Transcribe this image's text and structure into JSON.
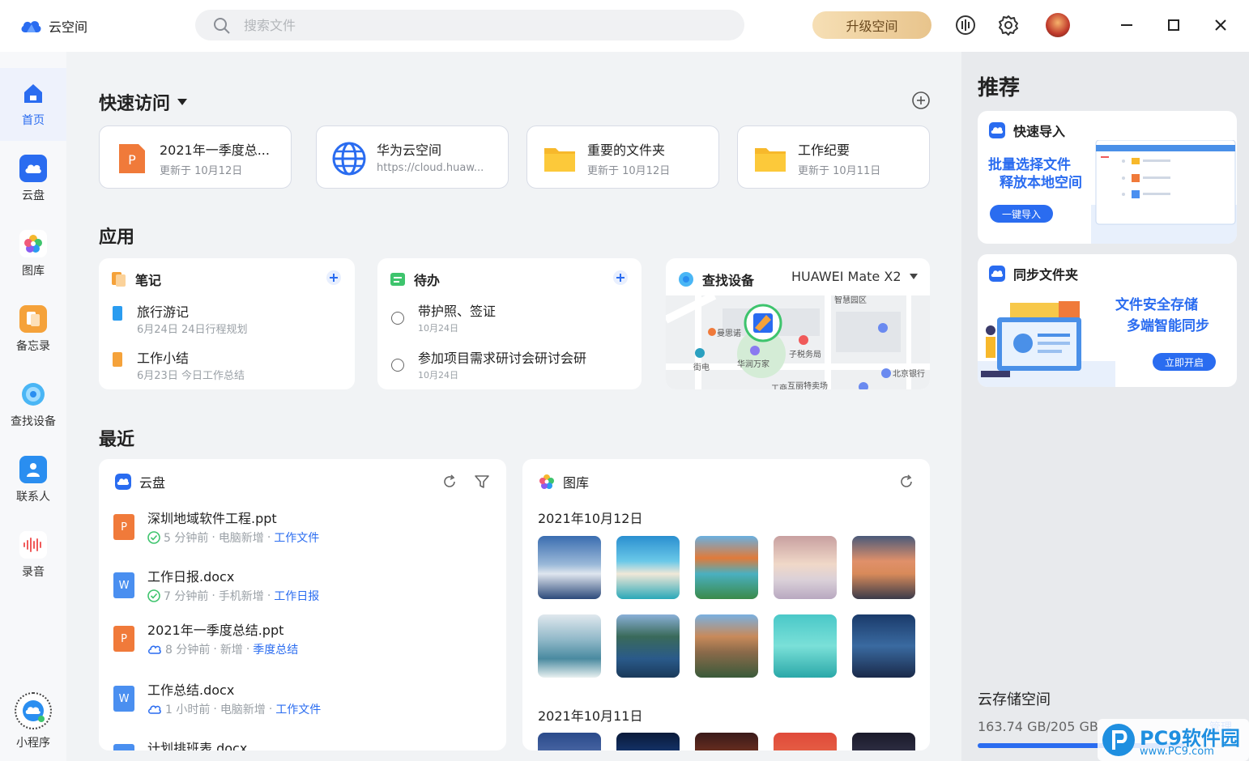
{
  "app": {
    "title": "云空间"
  },
  "search": {
    "placeholder": "搜索文件"
  },
  "toolbar": {
    "upgrade_label": "升级空间"
  },
  "nav": [
    {
      "label": "首页",
      "icon": "home-icon"
    },
    {
      "label": "云盘",
      "icon": "cloud-drive-icon"
    },
    {
      "label": "图库",
      "icon": "gallery-icon"
    },
    {
      "label": "备忘录",
      "icon": "memo-icon"
    },
    {
      "label": "查找设备",
      "icon": "find-device-icon"
    },
    {
      "label": "联系人",
      "icon": "contacts-icon"
    },
    {
      "label": "录音",
      "icon": "recording-icon"
    },
    {
      "label": "小程序",
      "icon": "mini-program-icon"
    }
  ],
  "quick_access": {
    "title": "快速访问",
    "items": [
      {
        "title": "2021年一季度总...",
        "sub": "更新于 10月12日",
        "type": "ppt"
      },
      {
        "title": "华为云空间",
        "sub": "https://cloud.huaw...",
        "type": "web"
      },
      {
        "title": "重要的文件夹",
        "sub": "更新于 10月12日",
        "type": "folder"
      },
      {
        "title": "工作纪要",
        "sub": "更新于 10月11日",
        "type": "folder"
      }
    ]
  },
  "apps": {
    "title": "应用",
    "notes": {
      "title": "笔记",
      "items": [
        {
          "title": "旅行游记",
          "sub": "6月24日   24日行程规划"
        },
        {
          "title": "工作小结",
          "sub": "6月23日   今日工作总结"
        }
      ]
    },
    "todo": {
      "title": "待办",
      "items": [
        {
          "title": "带护照、签证",
          "sub": "10月24日"
        },
        {
          "title": "参加项目需求研讨会研讨会研",
          "sub": "10月24日"
        }
      ]
    },
    "find_device": {
      "title": "查找设备",
      "device": "HUAWEI Mate X2",
      "map_labels": [
        "智慧园区",
        "曼思诺",
        "华润万家",
        "子税务局",
        "街电",
        "北京银行",
        "互丽特卖场",
        "工商"
      ]
    }
  },
  "recent": {
    "title": "最近",
    "drive": {
      "title": "云盘",
      "files": [
        {
          "name": "深圳地域软件工程.ppt",
          "type": "ppt",
          "time": "5 分钟前",
          "source": "电脑新增",
          "tag": "工作文件",
          "status": "synced"
        },
        {
          "name": "工作日报.docx",
          "type": "doc",
          "time": "7 分钟前",
          "source": "手机新增",
          "tag": "工作日报",
          "status": "synced"
        },
        {
          "name": "2021年一季度总结.ppt",
          "type": "ppt",
          "time": "8 分钟前",
          "source": "新增",
          "tag": "季度总结",
          "status": "cloud"
        },
        {
          "name": "工作总结.docx",
          "type": "doc",
          "time": "1 小时前",
          "source": "电脑新增",
          "tag": "工作文件",
          "status": "cloud"
        },
        {
          "name": "计划排班表.docx",
          "type": "doc"
        }
      ]
    },
    "gallery": {
      "title": "图库",
      "groups": [
        {
          "date": "2021年10月12日"
        },
        {
          "date": "2021年10月11日"
        }
      ]
    }
  },
  "recommend": {
    "title": "推荐",
    "cards": [
      {
        "title": "快速导入",
        "promo_line1": "批量选择文件",
        "promo_line2": "释放本地空间",
        "button": "一键导入"
      },
      {
        "title": "同步文件夹",
        "promo_line1": "文件安全存储",
        "promo_line2": "多端智能同步",
        "button": "立即开启"
      }
    ]
  },
  "storage": {
    "title": "云存储空间",
    "used": "163.74 GB/205 GB",
    "used_fraction": 0.8,
    "manage": "管理"
  },
  "watermark": {
    "brand": "PC9软件园",
    "url": "www.PC9.com"
  },
  "colors": {
    "accent": "#2a6cf0",
    "ppt": "#f07a3a",
    "doc": "#4a8ff0",
    "folder": "#f7b82b"
  }
}
